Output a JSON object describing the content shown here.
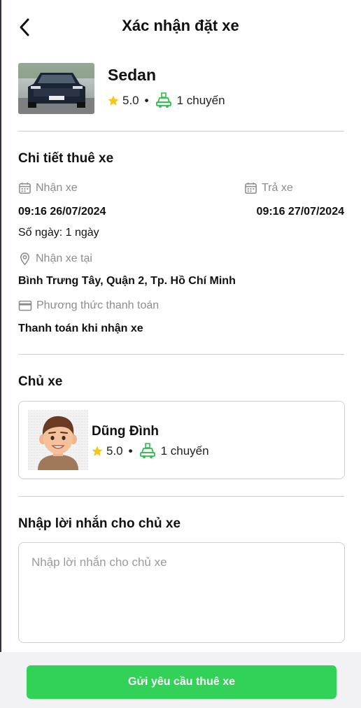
{
  "header": {
    "title": "Xác nhận đặt xe"
  },
  "car": {
    "name": "Sedan",
    "rating": "5.0",
    "separator": "•",
    "trips": "1 chuyến"
  },
  "rental": {
    "section_title": "Chi tiết thuê xe",
    "pickup_label": "Nhận xe",
    "pickup_value": "09:16 26/07/2024",
    "return_label": "Trả xe",
    "return_value": "09:16 27/07/2024",
    "days": "Số ngày: 1 ngày",
    "location_label": "Nhận xe tại",
    "location_value": "Bình Trưng Tây, Quận 2, Tp. Hồ Chí Minh",
    "payment_label": "Phương thức thanh toán",
    "payment_value": "Thanh toán khi nhận xe"
  },
  "owner": {
    "section_title": "Chủ xe",
    "name": "Dũng Đình",
    "rating": "5.0",
    "separator": "•",
    "trips": "1 chuyến"
  },
  "message": {
    "section_title": "Nhập lời nhắn cho chủ xe",
    "placeholder": "Nhập lời nhắn cho chủ xe",
    "value": ""
  },
  "footer": {
    "submit_label": "Gửi yêu cầu thuê xe"
  },
  "colors": {
    "primary": "#32d157",
    "star": "#f5c518",
    "trip_icon": "#2fbf4a",
    "muted": "#8c8c8c",
    "divider": "#cfcfcf"
  },
  "icons": [
    "back-arrow-icon",
    "star-icon",
    "car-trip-icon",
    "calendar-icon",
    "location-pin-icon",
    "credit-card-icon"
  ]
}
